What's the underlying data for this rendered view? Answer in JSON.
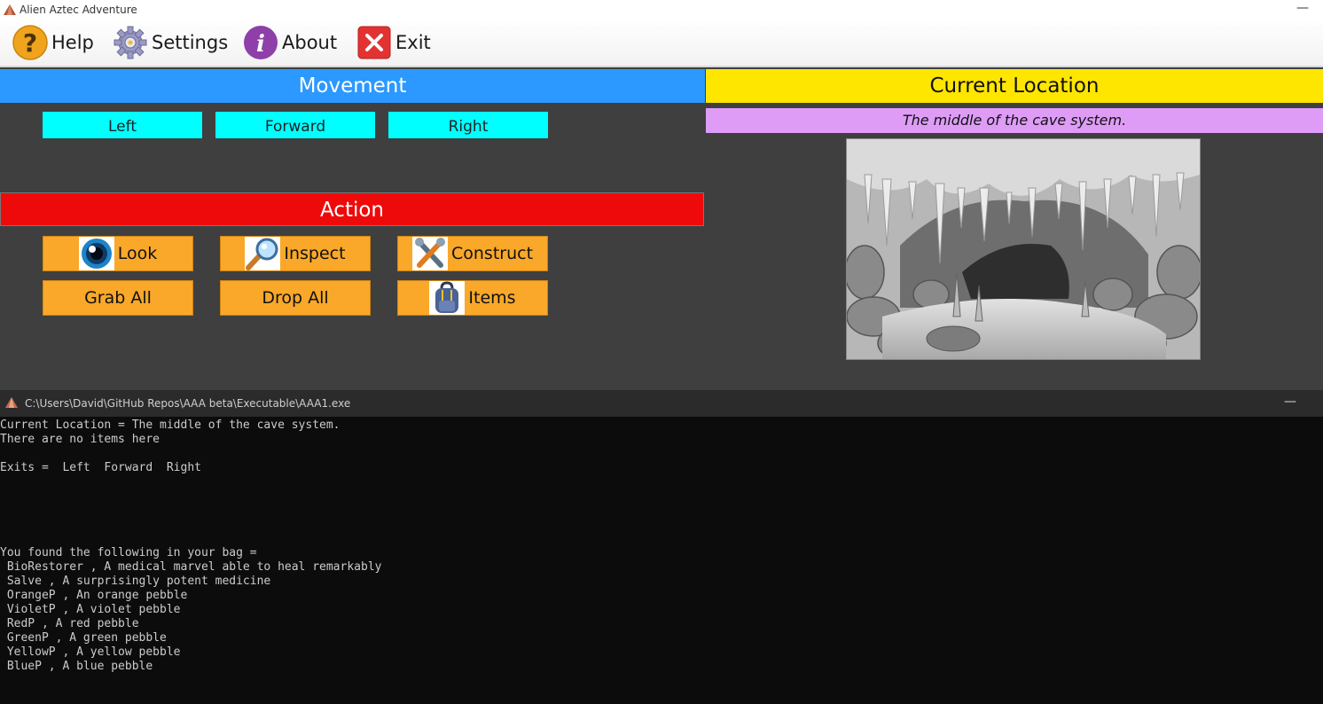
{
  "window": {
    "title": "Alien Aztec Adventure",
    "minimize": "—"
  },
  "menu": {
    "help": "Help",
    "settings": "Settings",
    "about": "About",
    "exit": "Exit"
  },
  "movement": {
    "header": "Movement",
    "left": "Left",
    "forward": "Forward",
    "right": "Right"
  },
  "action": {
    "header": "Action",
    "look": "Look",
    "inspect": "Inspect",
    "construct": "Construct",
    "grab_all": "Grab All",
    "drop_all": "Drop All",
    "items": "Items"
  },
  "location": {
    "header": "Current Location",
    "description": "The middle of the cave system."
  },
  "console_window": {
    "path": "C:\\Users\\David\\GitHub Repos\\AAA beta\\Executable\\AAA1.exe",
    "minimize": "—"
  },
  "console_lines": [
    "Current Location = The middle of the cave system.",
    "There are no items here",
    "",
    "Exits =  Left  Forward  Right",
    "",
    "",
    "",
    "",
    "",
    "You found the following in your bag =",
    " BioRestorer , A medical marvel able to heal remarkably",
    " Salve , A surprisingly potent medicine",
    " OrangeP , An orange pebble",
    " VioletP , A violet pebble",
    " RedP , A red pebble",
    " GreenP , A green pebble",
    " YellowP , A yellow pebble",
    " BlueP , A blue pebble"
  ],
  "colors": {
    "movement_header": "#2b99ff",
    "location_header": "#ffe600",
    "action_header": "#ee0a0a",
    "move_button": "#00ffff",
    "action_button": "#f9a82a",
    "location_desc": "#de9cf7",
    "panel_bg": "#3f3f3f",
    "console_bg": "#0c0c0c"
  },
  "icons": {
    "help": "question-icon",
    "settings": "gear-icon",
    "about": "info-icon",
    "exit": "close-icon",
    "look": "eye-icon",
    "inspect": "magnifier-icon",
    "construct": "tools-icon",
    "items": "backpack-icon"
  }
}
